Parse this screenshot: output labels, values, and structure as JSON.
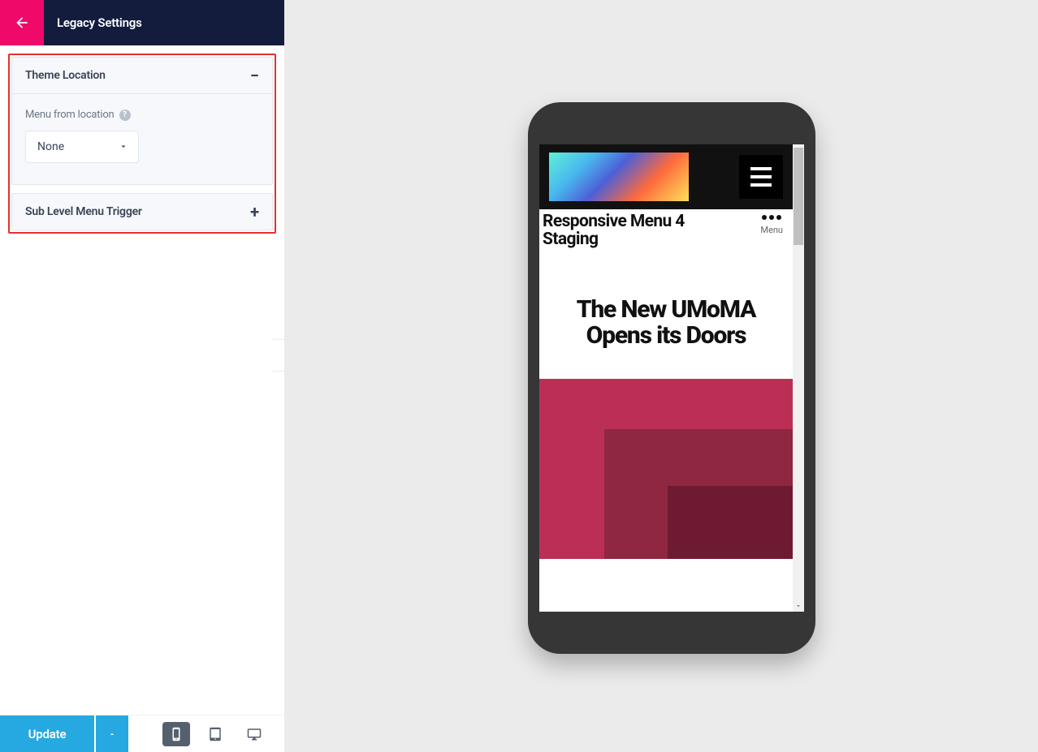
{
  "header": {
    "title": "Legacy Settings"
  },
  "sections": {
    "theme_location": {
      "title": "Theme Location",
      "field_label": "Menu from location",
      "select_value": "None"
    },
    "sub_level_menu_trigger": {
      "title": "Sub Level Menu Trigger"
    }
  },
  "bottom": {
    "update_label": "Update"
  },
  "preview": {
    "site_title_line1": "Responsive Menu 4",
    "site_title_line2": "Staging",
    "menu_label": "Menu",
    "headline_line1": "The New UMoMA",
    "headline_line2": "Opens its Doors"
  }
}
